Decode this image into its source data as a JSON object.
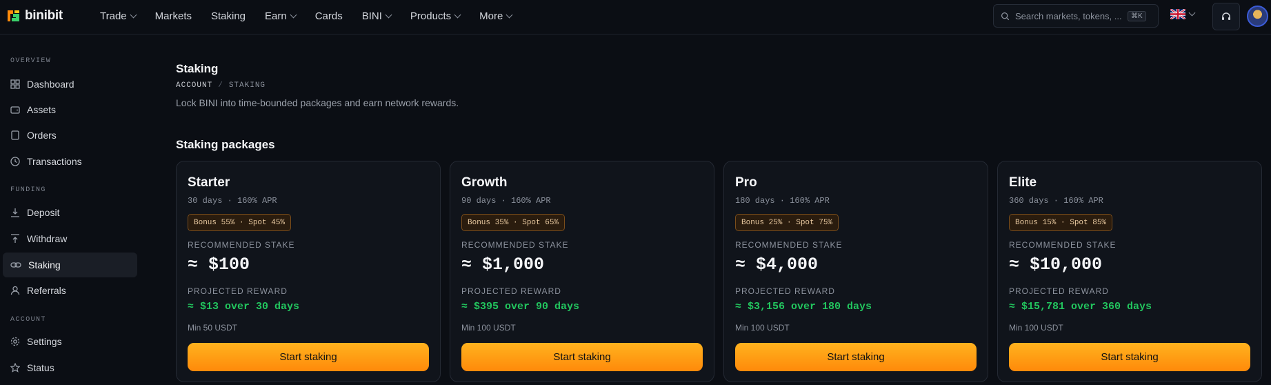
{
  "brand": {
    "name": "binibit"
  },
  "nav": {
    "items": [
      {
        "label": "Trade",
        "has_dropdown": true
      },
      {
        "label": "Markets",
        "has_dropdown": false
      },
      {
        "label": "Staking",
        "has_dropdown": false
      },
      {
        "label": "Earn",
        "has_dropdown": true
      },
      {
        "label": "Cards",
        "has_dropdown": false
      },
      {
        "label": "BINI",
        "has_dropdown": true
      },
      {
        "label": "Products",
        "has_dropdown": true
      },
      {
        "label": "More",
        "has_dropdown": true
      }
    ]
  },
  "search": {
    "placeholder": "Search markets, tokens, ...",
    "shortcut": "⌘K"
  },
  "header_icons": {
    "language": "uk-flag-icon",
    "support": "headset-icon"
  },
  "sidebar": {
    "overview_heading": "OVERVIEW",
    "overview": [
      {
        "label": "Dashboard",
        "icon": "grid-icon"
      },
      {
        "label": "Assets",
        "icon": "wallet-icon"
      },
      {
        "label": "Orders",
        "icon": "document-icon"
      },
      {
        "label": "Transactions",
        "icon": "clock-icon"
      }
    ],
    "funding_heading": "FUNDING",
    "funding": [
      {
        "label": "Deposit",
        "icon": "download-icon"
      },
      {
        "label": "Withdraw",
        "icon": "upload-icon"
      },
      {
        "label": "Staking",
        "icon": "link-icon",
        "active": true
      },
      {
        "label": "Referrals",
        "icon": "user-icon"
      }
    ],
    "account_heading": "ACCOUNT",
    "account": [
      {
        "label": "Settings",
        "icon": "gear-icon"
      },
      {
        "label": "Status",
        "icon": "star-icon"
      }
    ]
  },
  "page": {
    "title": "Staking",
    "breadcrumb": [
      "ACCOUNT",
      "STAKING"
    ],
    "breadcrumb_sep": "/",
    "subtitle": "Lock BINI into time-bounded packages and earn network rewards.",
    "section_title": "Staking packages"
  },
  "packages": [
    {
      "name": "Starter",
      "meta": "30 days · 160% APR",
      "badge": "Bonus 55% · Spot 45%",
      "stake_label": "RECOMMENDED STAKE",
      "stake": "≈ $100",
      "reward_label": "PROJECTED REWARD",
      "reward": "≈ $13 over 30 days",
      "min": "Min 50 USDT",
      "button": "Start staking"
    },
    {
      "name": "Growth",
      "meta": "90 days · 160% APR",
      "badge": "Bonus 35% · Spot 65%",
      "stake_label": "RECOMMENDED STAKE",
      "stake": "≈ $1,000",
      "reward_label": "PROJECTED REWARD",
      "reward": "≈ $395 over 90 days",
      "min": "Min 100 USDT",
      "button": "Start staking"
    },
    {
      "name": "Pro",
      "meta": "180 days · 160% APR",
      "badge": "Bonus 25% · Spot 75%",
      "stake_label": "RECOMMENDED STAKE",
      "stake": "≈ $4,000",
      "reward_label": "PROJECTED REWARD",
      "reward": "≈ $3,156 over 180 days",
      "min": "Min 100 USDT",
      "button": "Start staking"
    },
    {
      "name": "Elite",
      "meta": "360 days · 160% APR",
      "badge": "Bonus 15% · Spot 85%",
      "stake_label": "RECOMMENDED STAKE",
      "stake": "≈ $10,000",
      "reward_label": "PROJECTED REWARD",
      "reward": "≈ $15,781 over 360 days",
      "min": "Min 100 USDT",
      "button": "Start staking"
    }
  ],
  "colors": {
    "background": "#0b0e14",
    "accent": "#ff9a12",
    "reward": "#22c55e"
  }
}
